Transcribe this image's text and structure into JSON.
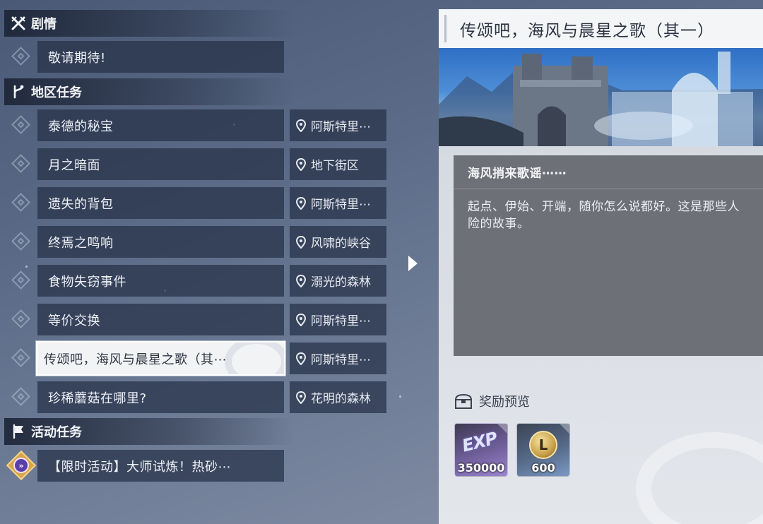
{
  "sections": {
    "story": {
      "title": "剧情",
      "icon": "crossed-swords-icon"
    },
    "regional": {
      "title": "地区任务",
      "icon": "branch-icon"
    },
    "event": {
      "title": "活动任务",
      "icon": "flag-icon"
    }
  },
  "story_quests": [
    {
      "name": "敬请期待!"
    }
  ],
  "regional_quests": [
    {
      "name": "泰德的秘宝",
      "location": "阿斯特里⋯"
    },
    {
      "name": "月之暗面",
      "location": "地下街区"
    },
    {
      "name": "遗失的背包",
      "location": "阿斯特里⋯"
    },
    {
      "name": "终焉之鸣响",
      "location": "风啸的峡谷"
    },
    {
      "name": "食物失窃事件",
      "location": "溺光的森林"
    },
    {
      "name": "等价交换",
      "location": "阿斯特里⋯"
    },
    {
      "name": "传颂吧，海风与晨星之歌（其⋯",
      "location": "阿斯特里⋯",
      "selected": true
    },
    {
      "name": "珍稀蘑菇在哪里?",
      "location": "花明的森林"
    }
  ],
  "event_quests": [
    {
      "name": "【限时活动】大师试炼！热砂⋯",
      "icon": "fast-forward-badge-icon"
    }
  ],
  "detail": {
    "title": "传颂吧，海风与晨星之歌（其一）",
    "subtitle": "海风捎来歌谣⋯⋯",
    "description": "起点、伊始、开端，随你怎么说都好。这是那些人\n险的故事。",
    "rewards_label": "奖励预览",
    "rewards": [
      {
        "type": "exp",
        "glyph": "EXP",
        "amount": "350000"
      },
      {
        "type": "coin",
        "glyph": "L",
        "amount": "600"
      }
    ]
  },
  "colors": {
    "panel_bg": "#d8dce3",
    "selected_bg": "#f2f3f5",
    "desc_bg": "#6e7077",
    "event_accent": "#d9a54a"
  }
}
